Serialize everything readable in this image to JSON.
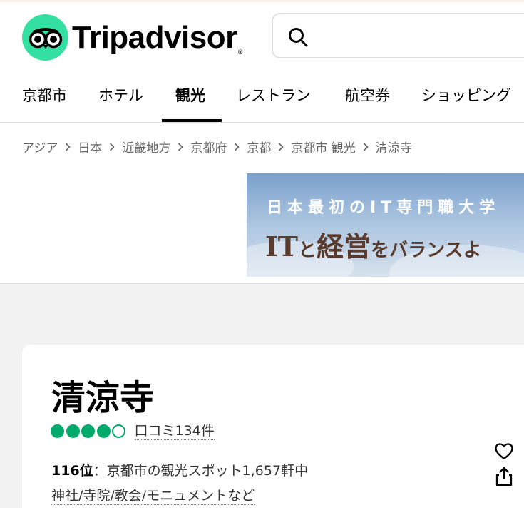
{
  "brand": {
    "name": "Tripadvisor",
    "registered_mark": "®",
    "logo_color": "#34e0a1"
  },
  "search": {
    "icon": "search-icon",
    "placeholder": ""
  },
  "nav": {
    "tabs": [
      {
        "label": "京都市",
        "active": false
      },
      {
        "label": "ホテル",
        "active": false
      },
      {
        "label": "観光",
        "active": true
      },
      {
        "label": "レストラン",
        "active": false
      },
      {
        "label": "航空券",
        "active": false
      },
      {
        "label": "ショッピング",
        "active": false
      }
    ]
  },
  "breadcrumb": [
    "アジア",
    "日本",
    "近畿地方",
    "京都府",
    "京都",
    "京都市 観光",
    "清涼寺"
  ],
  "ad": {
    "line1": "日本最初のIT専門職大学",
    "line2_big1": "IT",
    "line2_small1": "と",
    "line2_big2": "経営",
    "line2_small2": "をバランスよ"
  },
  "place": {
    "title": "清涼寺",
    "rating_bubbles": 4,
    "rating_max": 5,
    "review_text": "口コミ134件",
    "rank_number": "116位",
    "rank_text": "：京都市の観光スポット1,657軒中",
    "categories": "神社/寺院/教会/モニュメントなど"
  },
  "actions": {
    "save_icon": "heart-icon",
    "share_icon": "share-icon"
  },
  "colors": {
    "rating_green": "#00aa6c",
    "page_grey": "#f2f2f2"
  }
}
